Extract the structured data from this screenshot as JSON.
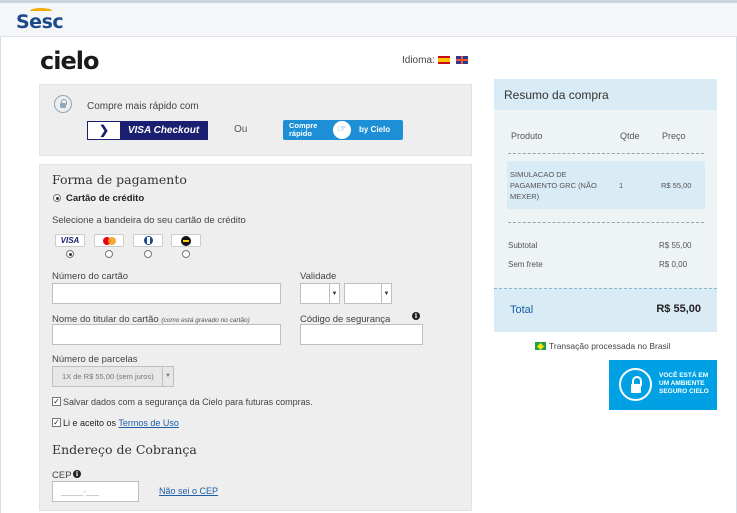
{
  "header": {
    "logo_text": "Sesc"
  },
  "brand": {
    "logo_text": "cielo",
    "language_label": "Idioma:"
  },
  "quick": {
    "text": "Compre mais rápido com",
    "visa_checkout": "VISA Checkout",
    "or": "Ou",
    "compre_rapido": "Compre rápido",
    "by_cielo": "by Cielo"
  },
  "payment": {
    "title": "Forma de pagamento",
    "method": "Cartão de crédito",
    "select_brand": "Selecione a bandeira do seu cartão de crédito",
    "brands": [
      "VISA",
      "Mastercard",
      "Diners",
      "Elo"
    ],
    "card_number_label": "Número do cartão",
    "validity_label": "Validade",
    "holder_label": "Nome do titular do cartão",
    "holder_note": "(como está gravado no cartão)",
    "security_label": "Código de segurança",
    "installments_label": "Número de parcelas",
    "installments_value": "1X de R$ 55,00 (sem juros)",
    "save_data": "Salvar dados com a segurança da Cielo para futuras compras.",
    "terms_prefix": "Li e aceito os",
    "terms_link": "Termos de Uso"
  },
  "billing": {
    "title": "Endereço de Cobrança",
    "cep_label": "CEP",
    "cep_placeholder": "_____-___",
    "cep_link": "Não sei o CEP"
  },
  "summary": {
    "title": "Resumo da compra",
    "col_product": "Produto",
    "col_qty": "Qtde",
    "col_price": "Preço",
    "item_name": "SIMULACAO DE PAGAMENTO GRC (NÃO MEXER)",
    "item_qty": "1",
    "item_price": "R$ 55,00",
    "subtotal_label": "Subtotal",
    "subtotal_value": "R$ 55,00",
    "shipping_label": "Sem frete",
    "shipping_value": "R$ 0,00",
    "total_label": "Total",
    "total_value": "R$ 55,00"
  },
  "footer": {
    "transaction": "Transação processada no Brasil",
    "secure_line1": "VOCÊ ESTÁ EM",
    "secure_line2": "UM AMBIENTE",
    "secure_line3": "SEGURO CIELO"
  },
  "colors": {
    "cielo_blue": "#00a1e4",
    "summary_bg": "#d9ebf4",
    "panel_bg": "#eeeeee"
  }
}
